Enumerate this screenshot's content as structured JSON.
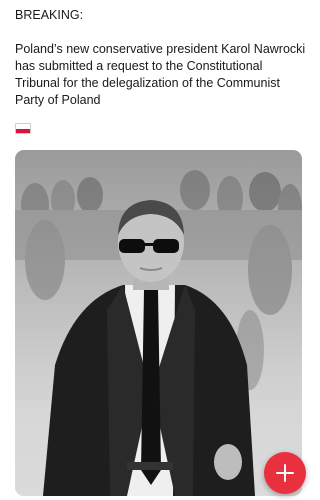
{
  "post": {
    "heading": "BREAKING:",
    "lines": [
      "Poland’s new conservative president Karol Nawrocki",
      "has submitted a request to the Constitutional",
      "Tribunal for the delegalization of the Communist",
      "Party of Poland"
    ],
    "flag_icon": "poland-flag-emoji",
    "flag_colors": [
      "#ffffff",
      "#dc143c"
    ]
  },
  "media": {
    "type": "photo-grayscale",
    "subject": "man-in-suit-sunglasses"
  },
  "fab": {
    "icon": "plus-icon",
    "color": "#e8303f"
  }
}
